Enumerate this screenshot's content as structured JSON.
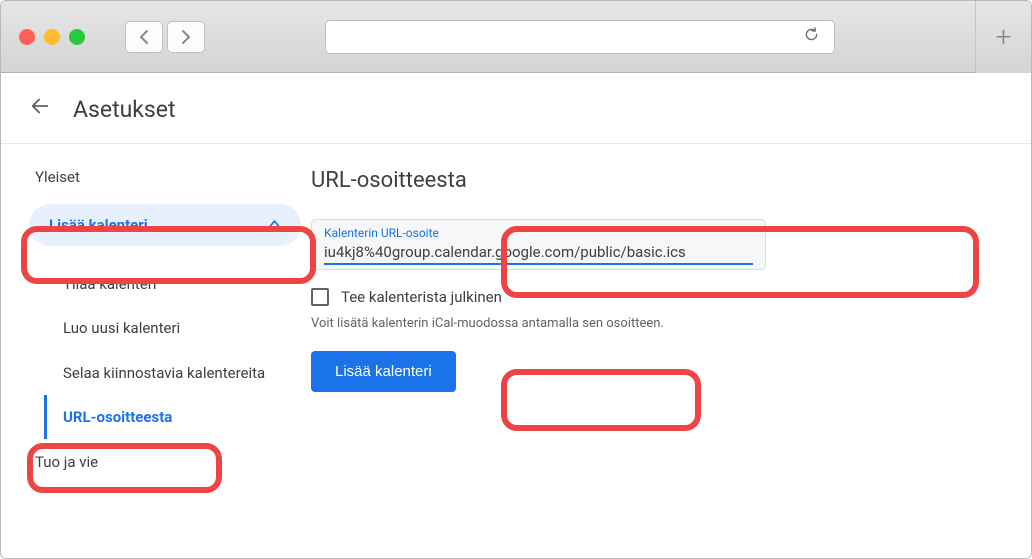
{
  "header": {
    "title": "Asetukset"
  },
  "sidebar": {
    "section_title": "Yleiset",
    "expand_label": "Lisää kalenteri",
    "items": [
      {
        "label": "Tilaa kalenteri"
      },
      {
        "label": "Luo uusi kalenteri"
      },
      {
        "label": "Selaa kiinnostavia kalentereita"
      },
      {
        "label": "URL-osoitteesta"
      }
    ],
    "below": "Tuo ja vie"
  },
  "panel": {
    "title": "URL-osoitteesta",
    "input_label": "Kalenterin URL-osoite",
    "input_value": "iu4kj8%40group.calendar.google.com/public/basic.ics",
    "checkbox_label": "Tee kalenterista julkinen",
    "helper": "Voit lisätä kalenterin iCal-muodossa antamalla sen osoitteen.",
    "button": "Lisää kalenteri"
  }
}
